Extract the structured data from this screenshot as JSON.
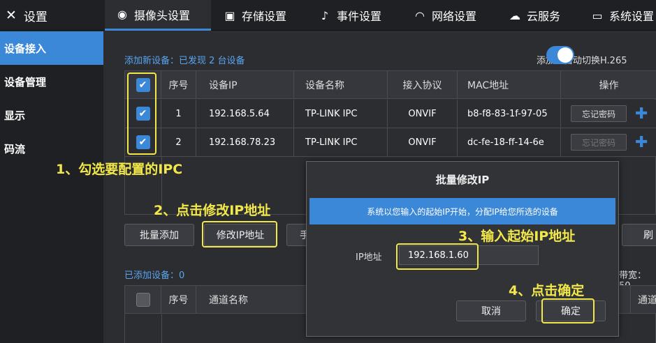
{
  "header": {
    "settings_title": "设置",
    "tabs": [
      {
        "label": "摄像头设置",
        "icon": "camera-icon"
      },
      {
        "label": "存储设置",
        "icon": "save-icon"
      },
      {
        "label": "事件设置",
        "icon": "bell-icon"
      },
      {
        "label": "网络设置",
        "icon": "wifi-icon"
      },
      {
        "label": "云服务",
        "icon": "cloud-icon"
      },
      {
        "label": "系统设置",
        "icon": "monitor-icon"
      }
    ]
  },
  "sidebar": {
    "items": [
      {
        "label": "设备接入",
        "active": true
      },
      {
        "label": "设备管理",
        "active": false
      },
      {
        "label": "显示",
        "active": false
      },
      {
        "label": "码流",
        "active": false
      }
    ]
  },
  "new_devices": {
    "header_label": "添加新设备：已发现 2 台设备",
    "auto_switch_label": "添加时自动切换H.265",
    "columns": [
      "序号",
      "设备IP",
      "设备名称",
      "接入协议",
      "MAC地址",
      "操作"
    ],
    "rows": [
      {
        "index": "1",
        "ip": "192.168.5.64",
        "name": "TP-LINK IPC",
        "protocol": "ONVIF",
        "mac": "b8-f8-83-1f-97-05",
        "action": "忘记密码"
      },
      {
        "index": "2",
        "ip": "192.168.78.23",
        "name": "TP-LINK IPC",
        "protocol": "ONVIF",
        "mac": "dc-fe-18-ff-14-6e",
        "action": "忘记密码"
      }
    ]
  },
  "buttons": {
    "batch_add": "批量添加",
    "modify_ip": "修改IP地址",
    "partial_hidden": "手",
    "refresh_partial": "刷"
  },
  "added_devices": {
    "header_label": "已添加设备：0",
    "bandwidth_partial": "带宽：50.",
    "columns": [
      "序号",
      "通道名称",
      "通道"
    ]
  },
  "dialog": {
    "title": "批量修改IP",
    "banner": "系统以您输入的起始IP开始，分配IP给您所选的设备",
    "ip_label": "IP地址",
    "ip_value": "192.168.1.60",
    "cancel": "取消",
    "confirm": "确定"
  },
  "annotations": {
    "step1": "1、勾选要配置的IPC",
    "step2": "2、点击修改IP地址",
    "step3": "3、输入起始IP地址",
    "step4": "4、点击确定",
    "highlight_color": "#f3e84a"
  },
  "colors": {
    "accent": "#3c88d8",
    "background": "#2b2d31",
    "bar": "#1e2023"
  }
}
